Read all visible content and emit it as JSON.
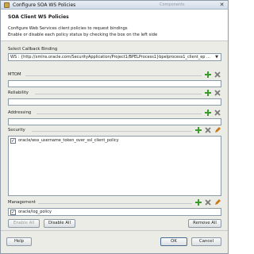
{
  "window": {
    "title": "Configure SOA WS Policies",
    "background_title": "Components"
  },
  "header": {
    "title": "SOA Client WS Policies",
    "desc_line1": "Configure Web Services client policies to request bindings",
    "desc_line2": "Enable or disable each policy status by checking the box on the left side"
  },
  "callback": {
    "label": "Select Callback Binding",
    "value": "WS : {http://xmlns.oracle.com/SecurityApplication/Project1/BPELProcess1}bpelprocess1_client_ep ..."
  },
  "sections": {
    "mtom": {
      "label": "MTOM"
    },
    "reliability": {
      "label": "Reliability"
    },
    "addressing": {
      "label": "Addressing"
    },
    "security": {
      "label": "Security",
      "items": [
        {
          "label": "oracle/wss_username_token_over_ssl_client_policy",
          "checked": true
        }
      ]
    },
    "management": {
      "label": "Management",
      "items": [
        {
          "label": "oracle/log_policy",
          "checked": true
        }
      ]
    }
  },
  "buttons": {
    "enable_all": "Enable All",
    "disable_all": "Disable All",
    "remove_all": "Remove All",
    "help": "Help",
    "ok": "OK",
    "cancel": "Cancel"
  },
  "colors": {
    "add_icon": "#3a9a2a",
    "delete_icon": "#7a7a7a",
    "edit_icon": "#c77a1e"
  }
}
